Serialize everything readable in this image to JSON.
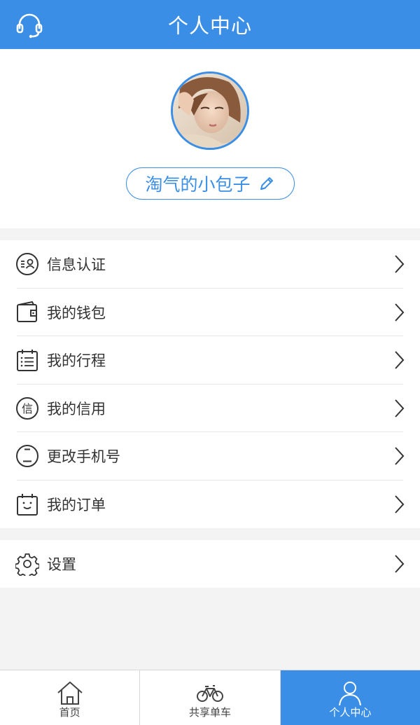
{
  "header": {
    "title": "个人中心",
    "service_icon": "headset-icon"
  },
  "profile": {
    "nickname": "淘气的小包子",
    "avatar": "avatar-photo",
    "edit_icon": "pencil-icon"
  },
  "menu": [
    {
      "label": "信息认证",
      "icon": "id-verify-icon"
    },
    {
      "label": "我的钱包",
      "icon": "wallet-icon"
    },
    {
      "label": "我的行程",
      "icon": "calendar-list-icon"
    },
    {
      "label": "我的信用",
      "icon": "credit-icon"
    },
    {
      "label": "更改手机号",
      "icon": "phone-icon"
    },
    {
      "label": "我的订单",
      "icon": "order-icon"
    }
  ],
  "settings": {
    "label": "设置",
    "icon": "gear-icon"
  },
  "tabbar": {
    "items": [
      {
        "label": "首页",
        "icon": "home-icon"
      },
      {
        "label": "共享单车",
        "icon": "bicycle-icon"
      },
      {
        "label": "个人中心",
        "icon": "user-icon",
        "active": true
      }
    ]
  },
  "colors": {
    "accent": "#3b8ee6",
    "background": "#f3f3f3"
  }
}
